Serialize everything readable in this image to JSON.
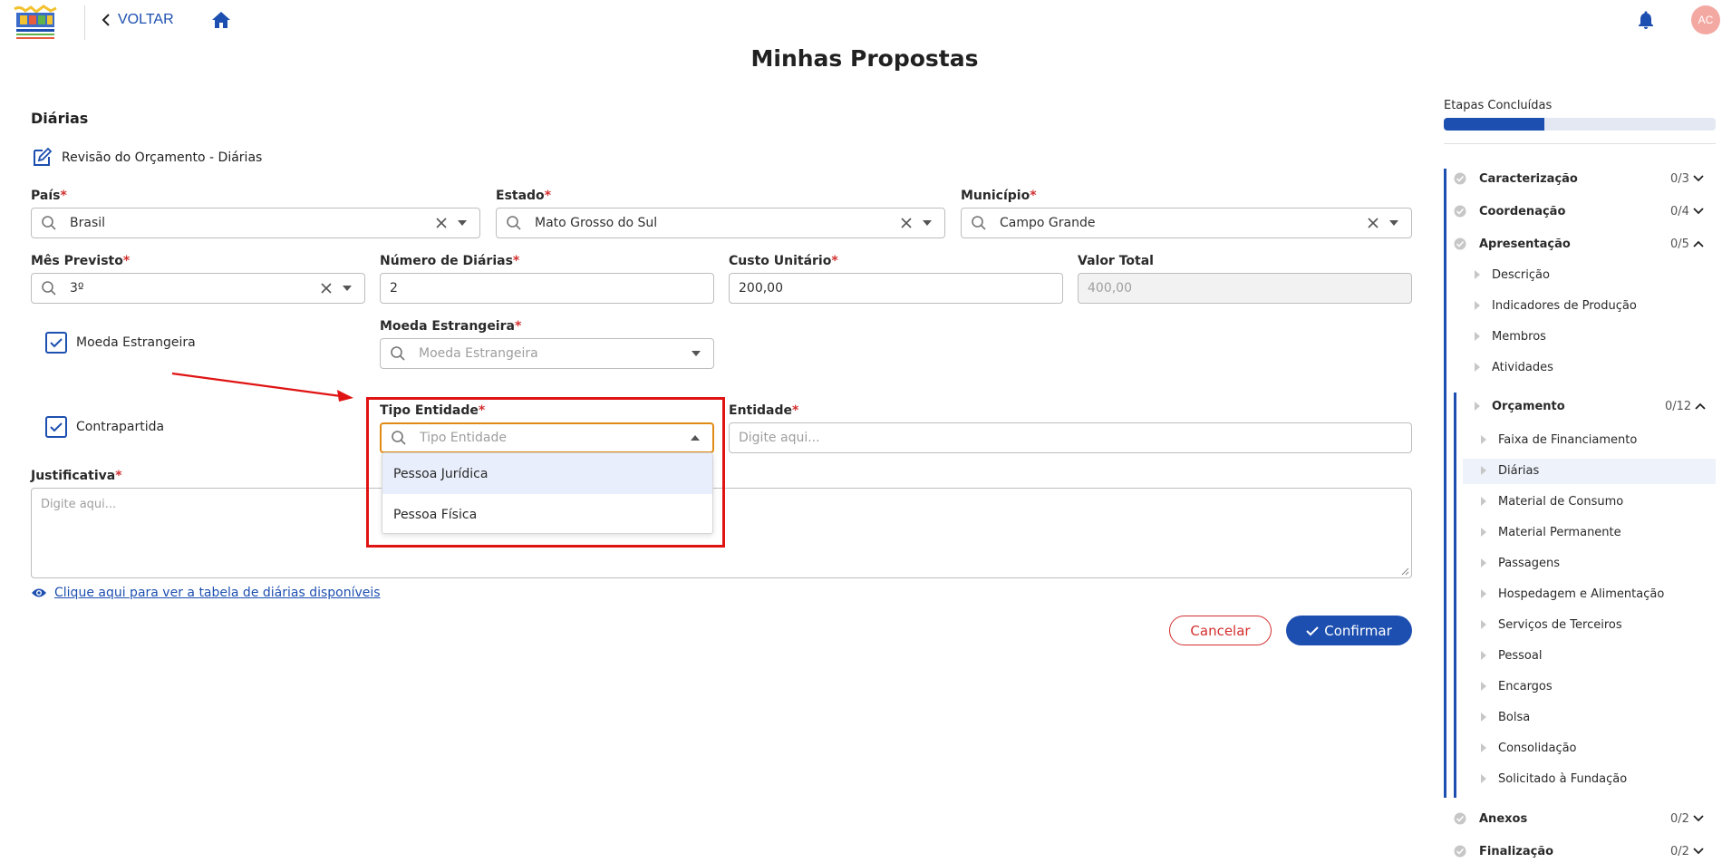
{
  "header": {
    "back_label": "VOLTAR",
    "avatar_initials": "AC",
    "page_title": "Minhas Propostas"
  },
  "form": {
    "section_title": "Diárias",
    "edit_title": "Revisão do Orçamento - Diárias",
    "pais": {
      "label": "País",
      "value": "Brasil"
    },
    "estado": {
      "label": "Estado",
      "value": "Mato Grosso do Sul"
    },
    "municipio": {
      "label": "Município",
      "value": "Campo Grande"
    },
    "mes_previsto": {
      "label": "Mês Previsto",
      "value": "3º"
    },
    "numero_diarias": {
      "label": "Número de Diárias",
      "value": "2"
    },
    "custo_unitario": {
      "label": "Custo Unitário",
      "value": "200,00"
    },
    "valor_total": {
      "label": "Valor Total",
      "value": "400,00"
    },
    "moeda_checkbox_label": "Moeda Estrangeira",
    "moeda": {
      "label": "Moeda Estrangeira",
      "placeholder": "Moeda Estrangeira"
    },
    "contrapartida_label": "Contrapartida",
    "tipo_entidade": {
      "label": "Tipo Entidade",
      "placeholder": "Tipo Entidade",
      "options": [
        "Pessoa Jurídica",
        "Pessoa Física"
      ]
    },
    "entidade": {
      "label": "Entidade",
      "placeholder": "Digite aqui..."
    },
    "justificativa": {
      "label": "Justificativa",
      "placeholder": "Digite aqui..."
    },
    "link_text": "Clique aqui para ver a tabela de diárias disponíveis",
    "cancel_label": "Cancelar",
    "confirm_label": "Confirmar"
  },
  "sidebar": {
    "title": "Etapas Concluídas",
    "progress": 0.37,
    "sections": [
      {
        "label": "Caracterização",
        "count": "0/3"
      },
      {
        "label": "Coordenação",
        "count": "0/4"
      },
      {
        "label": "Apresentação",
        "count": "0/5"
      }
    ],
    "apresentacao_items": [
      "Descrição",
      "Indicadores de Produção",
      "Membros",
      "Atividades"
    ],
    "orcamento": {
      "label": "Orçamento",
      "count": "0/12"
    },
    "orcamento_items": [
      "Faixa de Financiamento",
      "Diárias",
      "Material de Consumo",
      "Material Permanente",
      "Passagens",
      "Hospedagem e Alimentação",
      "Serviços de Terceiros",
      "Pessoal",
      "Encargos",
      "Bolsa",
      "Consolidação",
      "Solicitado à Fundação"
    ],
    "bottom_sections": [
      {
        "label": "Anexos",
        "count": "0/2"
      },
      {
        "label": "Finalização",
        "count": "0/2"
      }
    ]
  },
  "colors": {
    "primary": "#1d4fb0",
    "danger": "#d32f2f",
    "annotation": "#e01313"
  }
}
